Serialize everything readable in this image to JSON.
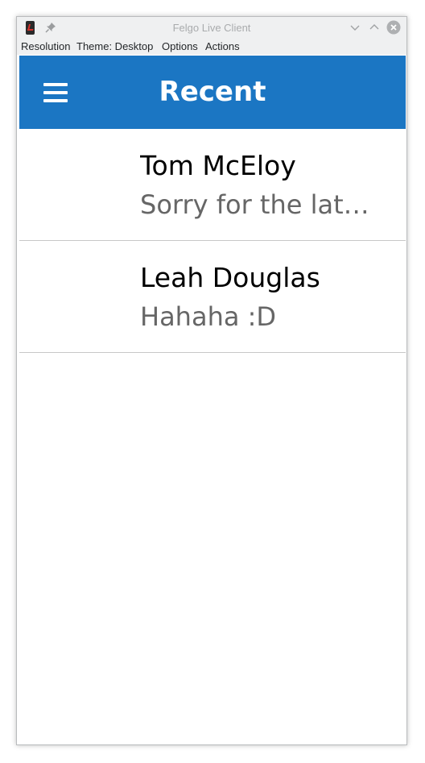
{
  "window": {
    "title": "Felgo Live Client"
  },
  "menubar": {
    "items": [
      {
        "label": "Resolution"
      },
      {
        "label": "Theme: Desktop"
      },
      {
        "label": "Options"
      },
      {
        "label": "Actions"
      }
    ]
  },
  "appbar": {
    "title": "Recent",
    "menu_icon": "hamburger-icon",
    "color": "#1b76c3"
  },
  "conversations": [
    {
      "name": "Tom McEloy",
      "message": "Sorry for the late…"
    },
    {
      "name": "Leah Douglas",
      "message": "Hahaha :D"
    }
  ]
}
